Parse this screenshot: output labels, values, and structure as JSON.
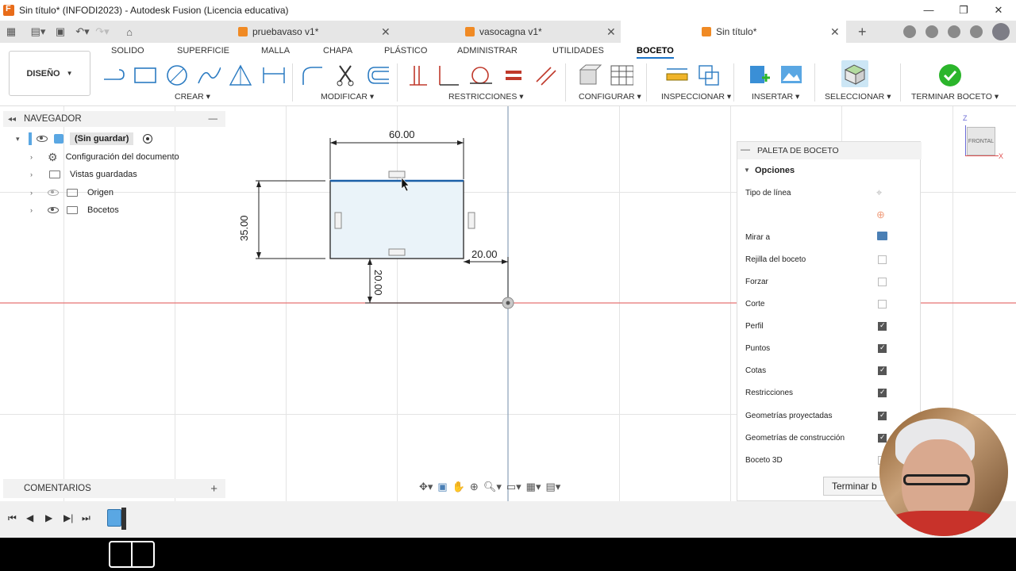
{
  "window": {
    "title": "Sin título* (INFODI2023) - Autodesk Fusion (Licencia educativa)"
  },
  "tabs": [
    {
      "label": "pruebavaso v1*"
    },
    {
      "label": "vasocagna v1*"
    },
    {
      "label": "Sin título*"
    }
  ],
  "ribbon": {
    "tabs": [
      "SOLIDO",
      "SUPERFICIE",
      "MALLA",
      "CHAPA",
      "PLÁSTICO",
      "ADMINISTRAR",
      "UTILIDADES",
      "BOCETO"
    ],
    "workspace": "DISEÑO",
    "groups": {
      "crear": "CREAR",
      "modificar": "MODIFICAR",
      "restricciones": "RESTRICCIONES",
      "configurar": "CONFIGURAR",
      "inspeccionar": "INSPECCIONAR",
      "insertar": "INSERTAR",
      "seleccionar": "SELECCIONAR",
      "terminar": "TERMINAR BOCETO"
    }
  },
  "navigator": {
    "title": "NAVEGADOR",
    "root": "(Sin guardar)",
    "items": [
      {
        "label": "Configuración del documento"
      },
      {
        "label": "Vistas guardadas"
      },
      {
        "label": "Origen"
      },
      {
        "label": "Bocetos"
      }
    ]
  },
  "comments": {
    "title": "COMENTARIOS"
  },
  "sketch": {
    "dims": {
      "width": "60.00",
      "height": "35.00",
      "offset_x": "20.00",
      "offset_y": "20.00"
    }
  },
  "palette": {
    "title": "PALETA DE BOCETO",
    "section": "Opciones",
    "rows": [
      {
        "label": "Tipo de línea",
        "checked": null
      },
      {
        "label": "Mirar a",
        "checked": null
      },
      {
        "label": "Rejilla del boceto",
        "checked": false
      },
      {
        "label": "Forzar",
        "checked": false
      },
      {
        "label": "Corte",
        "checked": false
      },
      {
        "label": "Perfil",
        "checked": true
      },
      {
        "label": "Puntos",
        "checked": true
      },
      {
        "label": "Cotas",
        "checked": true
      },
      {
        "label": "Restricciones",
        "checked": true
      },
      {
        "label": "Geometrías proyectadas",
        "checked": true
      },
      {
        "label": "Geometrías de construcción",
        "checked": true
      },
      {
        "label": "Boceto 3D",
        "checked": false
      }
    ],
    "finish_button": "Terminar b"
  },
  "viewcube": {
    "face": "FRONTAL",
    "axis_z": "Z",
    "axis_x": "X"
  },
  "colors": {
    "accent": "#1a73c8",
    "sketch_fill": "#eaf3f9",
    "sketch_line": "#1b5fa8",
    "origin_line": "#e57373",
    "finish_green": "#2bb52b"
  }
}
